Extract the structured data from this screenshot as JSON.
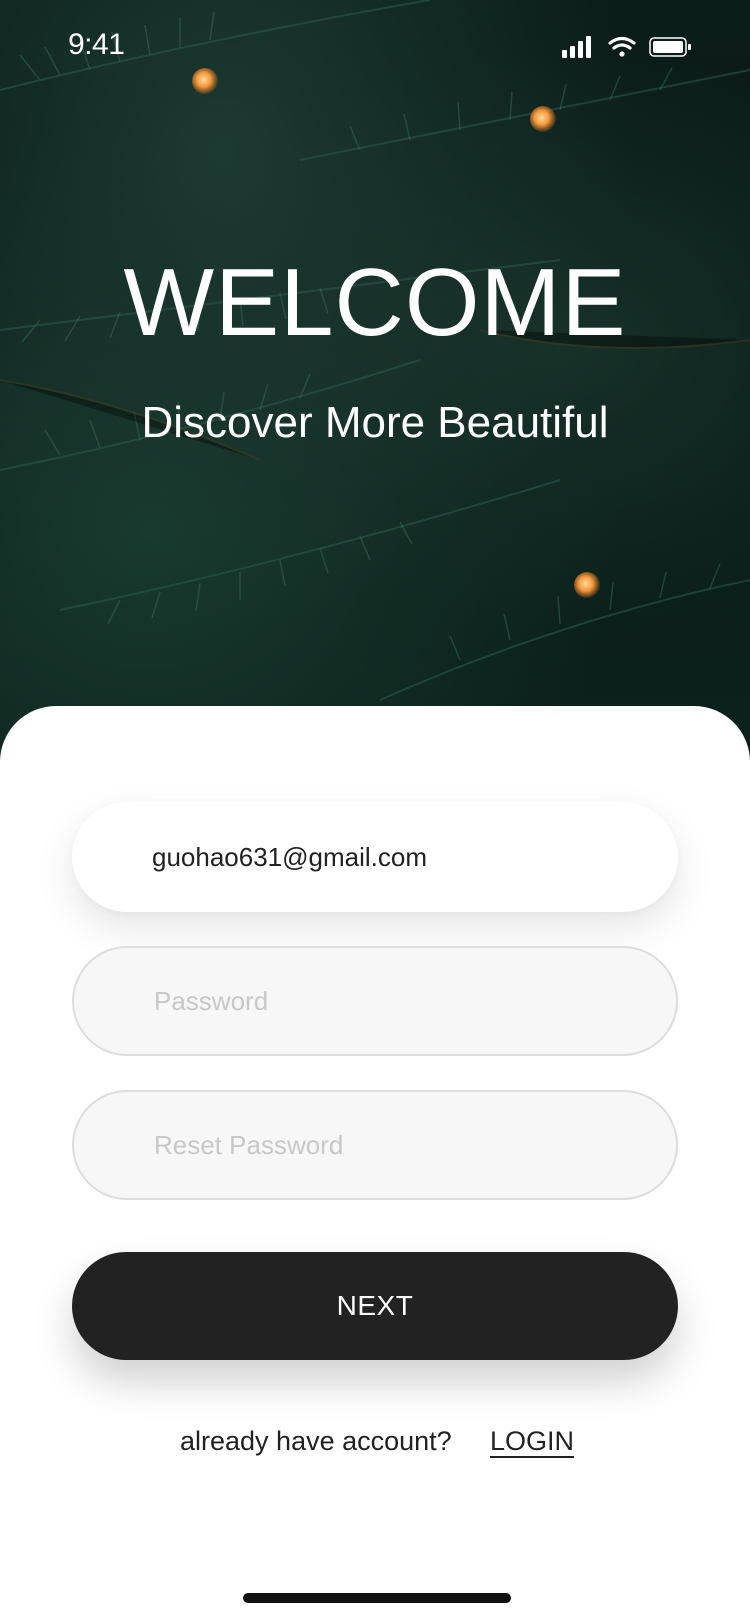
{
  "status_bar": {
    "time": "9:41",
    "icons": [
      "signal-icon",
      "wifi-icon",
      "battery-icon"
    ]
  },
  "hero": {
    "title": "WELCOME",
    "subtitle": "Discover More Beautiful"
  },
  "form": {
    "email_value": "guohao631@gmail.com",
    "password_placeholder": "Password",
    "reset_password_placeholder": "Reset Password",
    "next_label": "NEXT"
  },
  "footer": {
    "prompt": "already have account?",
    "login_label": "LOGIN"
  },
  "colors": {
    "primary_button": "#222222",
    "hero_background": "#0b1d19",
    "placeholder_text": "#c8c8c8",
    "field_fill": "#f7f7f7"
  }
}
